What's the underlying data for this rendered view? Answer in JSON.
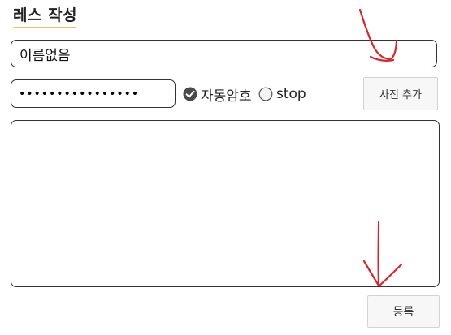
{
  "form": {
    "title": "레스 작성",
    "name_value": "이름없음",
    "password_value": "••••••••••••••••",
    "auto_password_label": "자동암호",
    "auto_password_checked": true,
    "stop_label": "stop",
    "stop_checked": false,
    "add_photo_label": "사진 추가",
    "content_value": "",
    "submit_label": "등록"
  },
  "colors": {
    "title_underline": "#f2c25a",
    "annotation_red": "#d8262b",
    "border": "#333333",
    "button_bg": "#f7f7f7"
  },
  "icons": {
    "auto_password": "check-circle-icon",
    "stop": "radio-empty-icon"
  }
}
